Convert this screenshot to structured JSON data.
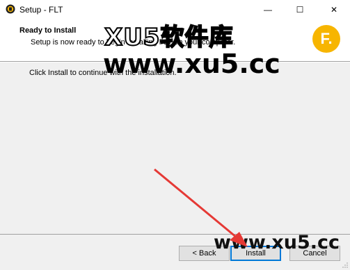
{
  "window": {
    "title": "Setup - FLT",
    "minimize_glyph": "—",
    "maximize_glyph": "☐",
    "close_glyph": "✕"
  },
  "header": {
    "title": "Ready to Install",
    "subtitle": "Setup is now ready to begin installing FLT on your computer.",
    "logo_letter": "F."
  },
  "body": {
    "instruction": "Click Install to continue with the installation."
  },
  "buttons": {
    "back": "< Back",
    "install": "Install",
    "cancel": "Cancel"
  },
  "watermark": {
    "line1": "XU5软件库",
    "line2": "www.xu5.cc",
    "line3": "www.xu5.cc"
  },
  "colors": {
    "accent": "#0078d7",
    "logo": "#f7b500",
    "arrow": "#e53935"
  }
}
